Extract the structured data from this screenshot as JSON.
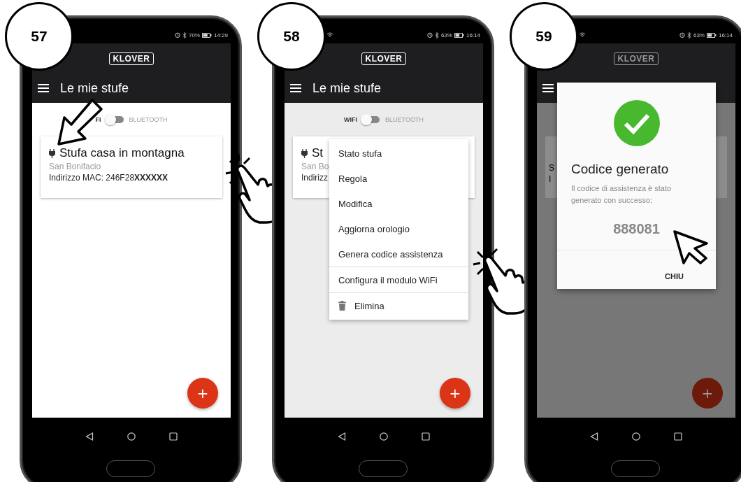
{
  "panels": [
    {
      "kind": "list",
      "step": "57",
      "status": {
        "wifi": false,
        "battery": "70%",
        "time": "14:29"
      },
      "logo": "KLOVER",
      "title": "Le mie stufe",
      "toggle": {
        "left": "FI",
        "right": "BLUETOOTH",
        "on": false
      },
      "card": {
        "name": "Stufa casa in montagna",
        "location": "San Bonifacio",
        "mac": "Indirizzo MAC: 246F28**XXXXXX**"
      },
      "fab": "+"
    },
    {
      "kind": "menu",
      "step": "58",
      "status": {
        "wifi": true,
        "battery": "63%",
        "time": "16:14"
      },
      "logo": "KLOVER",
      "title": "Le mie stufe",
      "toggle": {
        "left": "WIFI",
        "right": "BLUETOOTH",
        "on": false
      },
      "card": {
        "name": "St",
        "location": "San Bo",
        "mac": "Indirizz"
      },
      "fab": "+",
      "menu": [
        {
          "kind": "text",
          "label": "Stato stufa",
          "divider_before": false
        },
        {
          "kind": "text",
          "label": "Regola",
          "divider_before": false
        },
        {
          "kind": "text",
          "label": "Modifica",
          "divider_before": false
        },
        {
          "kind": "text",
          "label": "Aggiorna orologio",
          "divider_before": false
        },
        {
          "kind": "text",
          "label": "Genera codice assistenza",
          "divider_before": false
        },
        {
          "kind": "text",
          "label": "Configura il modulo WiFi",
          "divider_before": true
        },
        {
          "kind": "trash",
          "label": "Elimina",
          "divider_before": true
        }
      ]
    },
    {
      "kind": "dialog",
      "step": "59",
      "status": {
        "wifi": true,
        "battery": "63%",
        "time": "16:14"
      },
      "logo": "KLOVER",
      "card": {
        "location": "S",
        "mac": "I"
      },
      "fab": "+",
      "dialog": {
        "title": "Codice generato",
        "message": "Il codice di assistenza è stato generato con successo:",
        "code": "888081",
        "button": "CHIU"
      }
    }
  ]
}
